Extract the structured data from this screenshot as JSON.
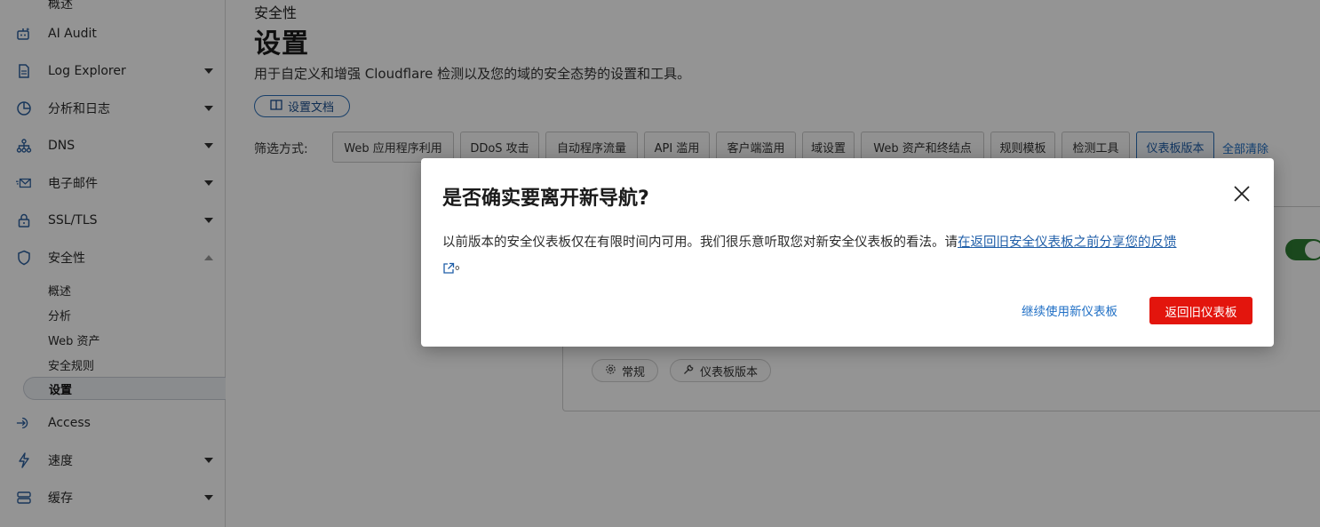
{
  "sidebar": {
    "items": [
      {
        "label": "概述",
        "icon": "overview-icon"
      },
      {
        "label": "AI Audit",
        "icon": "ai-robot-icon"
      },
      {
        "label": "Log Explorer",
        "icon": "log-document-icon"
      },
      {
        "label": "分析和日志",
        "icon": "pie-chart-icon"
      },
      {
        "label": "DNS",
        "icon": "dns-network-icon"
      },
      {
        "label": "电子邮件",
        "icon": "email-icon"
      },
      {
        "label": "SSL/TLS",
        "icon": "lock-icon"
      },
      {
        "label": "安全性",
        "icon": "shield-icon"
      },
      {
        "label": "Access",
        "icon": "access-login-icon"
      },
      {
        "label": "速度",
        "icon": "lightning-icon"
      },
      {
        "label": "缓存",
        "icon": "cache-storage-icon"
      }
    ],
    "security_sub_items": [
      {
        "label": "概述"
      },
      {
        "label": "分析"
      },
      {
        "label": "Web 资产"
      },
      {
        "label": "安全规则"
      },
      {
        "label": "设置"
      }
    ]
  },
  "main": {
    "section_title": "安全性",
    "page_title": "设置",
    "description": "用于自定义和增强 Cloudflare 检测以及您的域的安全态势的设置和工具。",
    "docs_button": "设置文档",
    "filter_label": "筛选方式:",
    "filters": [
      {
        "label": "Web 应用程序利用"
      },
      {
        "label": "DDoS 攻击"
      },
      {
        "label": "自动程序流量"
      },
      {
        "label": "API 滥用"
      },
      {
        "label": "客户端滥用"
      },
      {
        "label": "域设置"
      },
      {
        "label": "Web 资产和终结点"
      },
      {
        "label": "规则模板"
      },
      {
        "label": "检测工具"
      },
      {
        "label": "仪表板版本"
      }
    ],
    "clear_all": "全部清除",
    "card_tags": [
      {
        "label": "常规",
        "icon": "gear-icon"
      },
      {
        "label": "仪表板版本",
        "icon": "wrench-icon"
      }
    ]
  },
  "modal": {
    "title": "是否确实要离开新导航?",
    "body_text": "以前版本的安全仪表板仅在有限时间内可用。我们很乐意听取您对新安全仪表板的看法。请",
    "body_link": "在返回旧安全仪表板之前分享您的反馈",
    "body_end": "。",
    "continue_button": "继续使用新仪表板",
    "back_button": "返回旧仪表板"
  },
  "colors": {
    "accent_blue": "#1f6fc5",
    "danger_red": "#e3150d",
    "toggle_green": "#2e7d32"
  }
}
